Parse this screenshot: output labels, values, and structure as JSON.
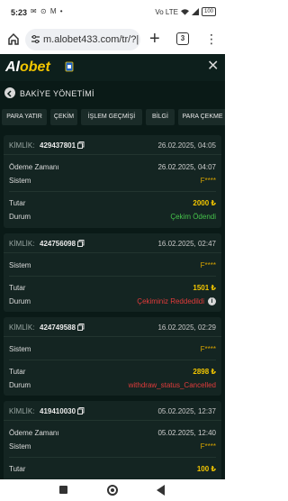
{
  "status_bar": {
    "time": "5:23",
    "left_icons": "✉ ⊙ M •",
    "signal": "Vo LTE",
    "battery": "100"
  },
  "browser": {
    "url": "m.alobet433.com/tr/?|",
    "tab_count": "3"
  },
  "app": {
    "logo_al": "Al",
    "logo_bet": "obet",
    "title": "BAKİYE YÖNETİMİ",
    "tabs": [
      "PARA YATIR",
      "ÇEKİM",
      "İŞLEM GEÇMİŞİ",
      "BİLGİ",
      "PARA ÇEKME"
    ]
  },
  "transactions": [
    {
      "id_label": "KİMLİK:",
      "id": "429437801",
      "date": "26.02.2025, 04:05",
      "payment_time_label": "Ödeme Zamanı",
      "payment_time": "26.02.2025, 04:07",
      "system_label": "Sistem",
      "system": "F****",
      "amount_label": "Tutar",
      "amount": "2000 ₺",
      "status_label": "Durum",
      "status": "Çekim Ödendi",
      "status_color": "#46c24b"
    },
    {
      "id_label": "KİMLİK:",
      "id": "424756098",
      "date": "16.02.2025, 02:47",
      "system_label": "Sistem",
      "system": "F****",
      "amount_label": "Tutar",
      "amount": "1501 ₺",
      "status_label": "Durum",
      "status": "Çekiminiz Reddedildi",
      "status_color": "#e23b3b"
    },
    {
      "id_label": "KİMLİK:",
      "id": "424749588",
      "date": "16.02.2025, 02:29",
      "system_label": "Sistem",
      "system": "F****",
      "amount_label": "Tutar",
      "amount": "2898 ₺",
      "status_label": "Durum",
      "status": "withdraw_status_Cancelled",
      "status_color": "#e23b3b"
    },
    {
      "id_label": "KİMLİK:",
      "id": "419410030",
      "date": "05.02.2025, 12:37",
      "payment_time_label": "Ödeme Zamanı",
      "payment_time": "05.02.2025, 12:40",
      "system_label": "Sistem",
      "system": "F****",
      "amount_label": "Tutar",
      "amount": "100 ₺"
    }
  ]
}
